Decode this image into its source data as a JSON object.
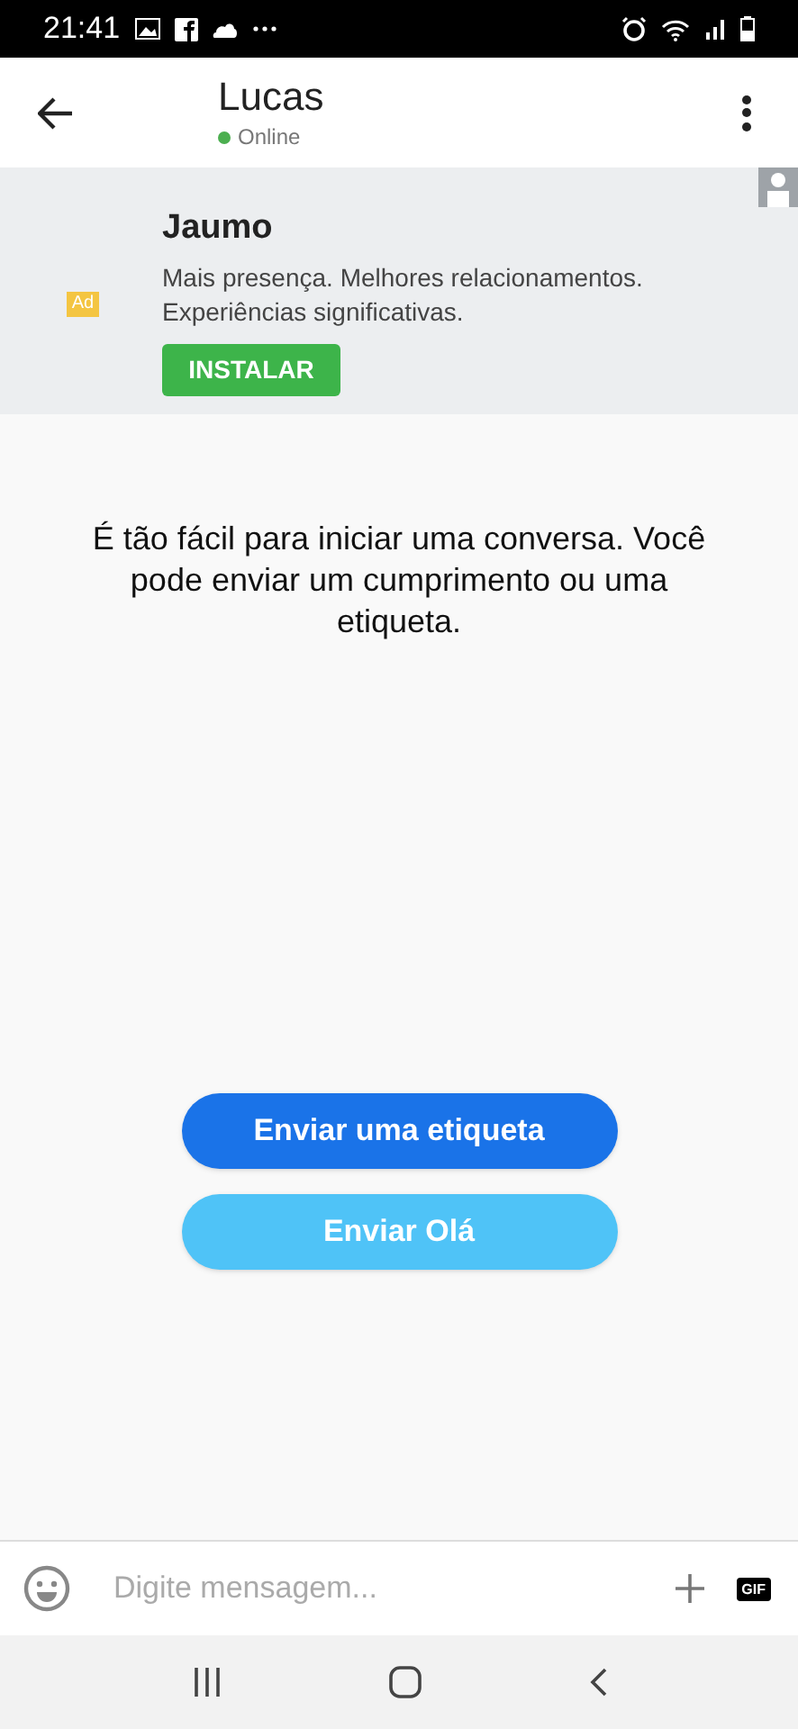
{
  "status_bar": {
    "time": "21:41"
  },
  "header": {
    "name": "Lucas",
    "presence": "Online",
    "online": true
  },
  "ad": {
    "badge": "Ad",
    "title": "Jaumo",
    "description": "Mais presença. Melhores relacionamentos. Experiências significativas.",
    "button": "INSTALAR"
  },
  "chat": {
    "intro": "É tão fácil para iniciar uma conversa. Você pode enviar um cumprimento ou uma etiqueta.",
    "buttons": [
      {
        "label": "Enviar uma etiqueta",
        "kind": "primary"
      },
      {
        "label": "Enviar Olá",
        "kind": "secondary"
      }
    ]
  },
  "composer": {
    "placeholder": "Digite mensagem...",
    "gif": "GIF"
  }
}
